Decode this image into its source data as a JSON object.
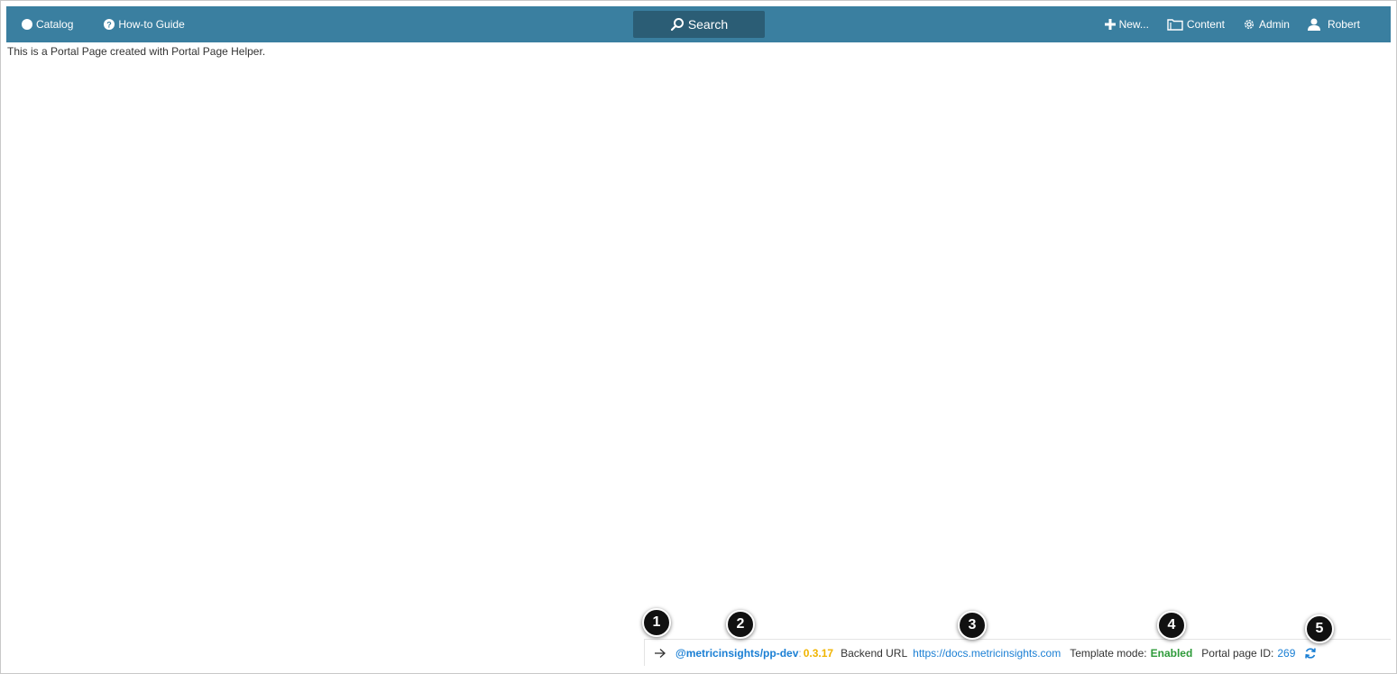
{
  "nav": {
    "catalog": "Catalog",
    "howto": "How-to Guide",
    "search": "Search",
    "new": "New...",
    "content": "Content",
    "admin": "Admin",
    "user": "Robert"
  },
  "page": {
    "text": "This is a Portal Page created with Portal Page Helper."
  },
  "helper": {
    "package": "@metricinsights/pp-dev",
    "version": "0.3.17",
    "backend_label": "Backend URL",
    "backend_url": "https://docs.metricinsights.com",
    "template_label": "Template mode:",
    "template_value": "Enabled",
    "pid_label": "Portal page ID:",
    "pid_value": "269"
  },
  "callouts": [
    "1",
    "2",
    "3",
    "4",
    "5"
  ],
  "colors": {
    "topbar": "#3a7fa0",
    "search": "#2b5d75",
    "link": "#1a7fd4",
    "version": "#f0b400",
    "enabled": "#2e9b3a"
  }
}
